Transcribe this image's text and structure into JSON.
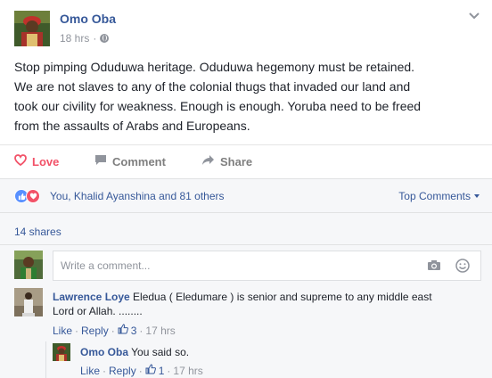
{
  "post": {
    "author": "Omo Oba",
    "time": "18 hrs",
    "dot": "·",
    "text": "Stop pimping Oduduwa heritage. Oduduwa hegemony must be retained.\nWe are not slaves to any of the colonial thugs that invaded our land and\ntook our civility for weakness. Enough is enough. Yoruba need to be freed\nfrom the assaults of Arabs and Europeans."
  },
  "actions": {
    "love": "Love",
    "comment": "Comment",
    "share": "Share"
  },
  "reactions": {
    "summary": "You, Khalid Ayanshina and 81 others",
    "sort_label": "Top Comments"
  },
  "shares": "14 shares",
  "composer": {
    "placeholder": "Write a comment..."
  },
  "comments": [
    {
      "author": "Lawrence Loye",
      "text_line1": " Eledua ( Eledumare ) is senior and supreme to any middle east",
      "text_line2": "Lord or Allah. ........",
      "like": "Like",
      "reply": "Reply",
      "likes": "3",
      "time": "17 hrs"
    },
    {
      "author": "Omo Oba",
      "text": " You said so.",
      "like": "Like",
      "reply": "Reply",
      "likes": "1",
      "time": "17 hrs"
    }
  ],
  "sep": "·",
  "colors": {
    "link": "#365899",
    "love": "#f25268",
    "like_blue": "#5890ff",
    "muted": "#90949c"
  },
  "icons": [
    "globe-icon",
    "chevron-down-icon",
    "love-heart-icon",
    "comment-icon",
    "share-arrow-icon",
    "like-reaction-icon",
    "love-reaction-icon",
    "camera-icon",
    "smiley-icon",
    "thumbs-up-icon"
  ]
}
